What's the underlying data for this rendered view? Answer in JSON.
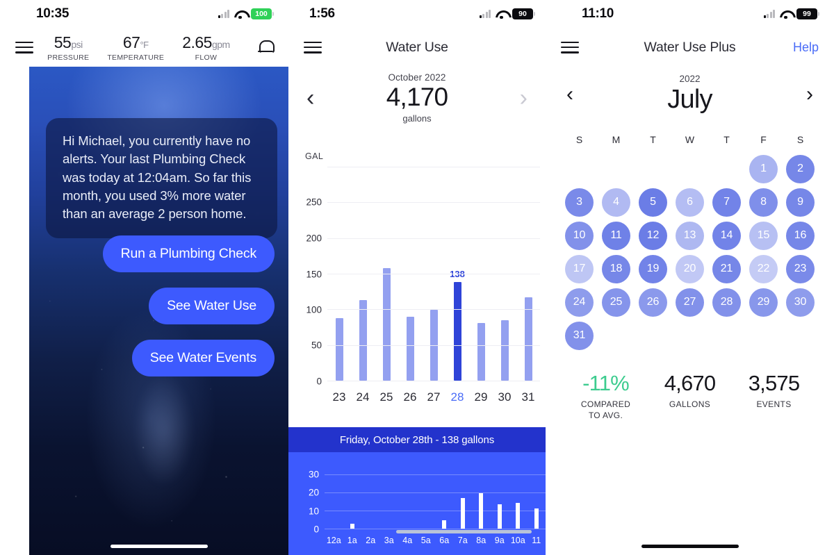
{
  "accent": {
    "blue": "#3d5afe",
    "bar_light": "#93a0f0",
    "bar_selected": "#2f44d8",
    "green": "#3dcc8f",
    "link": "#4a6cf7"
  },
  "panel1": {
    "status": {
      "time": "10:35",
      "battery": "100",
      "battery_color": "#2fd158",
      "battery_text_color": "#ffffff"
    },
    "nav": {
      "menu_icon": "hamburger-icon",
      "bell_icon": "bell-icon",
      "metrics": [
        {
          "value": "55",
          "unit": "psi",
          "label": "PRESSURE"
        },
        {
          "value": "67",
          "unit": "°F",
          "label": "TEMPERATURE"
        },
        {
          "value": "2.65",
          "unit": "gpm",
          "label": "FLOW"
        }
      ]
    },
    "message": "Hi Michael, you currently have no alerts. Your last Plumbing Check was today at 12:04am. So far this month, you used 3% more water than an average 2 person home.",
    "buttons": [
      "Run a Plumbing Check",
      "See Water Use",
      "See Water Events"
    ]
  },
  "panel2": {
    "status": {
      "time": "1:56",
      "battery": "90",
      "battery_color": "#0b0b0f",
      "battery_text_color": "#ffffff"
    },
    "nav": {
      "title": "Water Use",
      "menu_icon": "hamburger-icon"
    },
    "period": {
      "prev_icon": "chevron-left-icon",
      "next_icon": "chevron-right-icon",
      "label": "October 2022",
      "total": "4,170",
      "unit": "gallons"
    },
    "detail": {
      "title": "Friday, October 28th - 138 gallons"
    },
    "chart_data": {
      "type": "bar",
      "title": "October 2022 daily water use",
      "xlabel": "",
      "ylabel": "GAL",
      "axis_unit_label": "GAL",
      "categories": [
        "23",
        "24",
        "25",
        "26",
        "27",
        "28",
        "29",
        "30",
        "31"
      ],
      "values": [
        88,
        113,
        158,
        90,
        99,
        138,
        81,
        85,
        117
      ],
      "yticks": [
        0,
        50,
        100,
        150,
        200,
        250
      ],
      "ylim": [
        0,
        300
      ],
      "grid": true,
      "selected_index": 5,
      "selected_label": "138",
      "legend": "none"
    },
    "detail_chart_data": {
      "type": "bar",
      "title": "Friday, October 28th - 138 gallons",
      "xlabel": "",
      "ylabel": "",
      "categories": [
        "12a",
        "1a",
        "2a",
        "3a",
        "4a",
        "5a",
        "6a",
        "7a",
        "8a",
        "9a",
        "10a",
        "11"
      ],
      "values": [
        0,
        2.5,
        0,
        0,
        0,
        0,
        4.5,
        17,
        19.5,
        13.5,
        14,
        11
      ],
      "yticks": [
        0,
        10,
        20,
        30
      ],
      "ylim": [
        0,
        36
      ],
      "grid": true,
      "scrollbar": true
    }
  },
  "panel3": {
    "status": {
      "time": "11:10",
      "battery": "99",
      "battery_color": "#0b0b0f",
      "battery_text_color": "#ffffff"
    },
    "nav": {
      "title": "Water Use Plus",
      "menu_icon": "hamburger-icon",
      "help": "Help"
    },
    "period": {
      "prev_icon": "chevron-left-icon",
      "next_icon": "chevron-right-icon",
      "year": "2022",
      "month": "July"
    },
    "calendar": {
      "dow": [
        "S",
        "M",
        "T",
        "W",
        "T",
        "F",
        "S"
      ],
      "weeks": [
        [
          null,
          null,
          null,
          null,
          null,
          {
            "d": "1",
            "a": 0.55
          },
          {
            "d": "2",
            "a": 0.88
          }
        ],
        [
          {
            "d": "3",
            "a": 0.85
          },
          {
            "d": "4",
            "a": 0.5
          },
          {
            "d": "5",
            "a": 0.95
          },
          {
            "d": "6",
            "a": 0.48
          },
          {
            "d": "7",
            "a": 0.9
          },
          {
            "d": "8",
            "a": 0.82
          },
          {
            "d": "9",
            "a": 0.88
          }
        ],
        [
          {
            "d": "10",
            "a": 0.8
          },
          {
            "d": "11",
            "a": 0.92
          },
          {
            "d": "12",
            "a": 0.95
          },
          {
            "d": "13",
            "a": 0.52
          },
          {
            "d": "14",
            "a": 0.9
          },
          {
            "d": "15",
            "a": 0.46
          },
          {
            "d": "16",
            "a": 0.88
          }
        ],
        [
          {
            "d": "17",
            "a": 0.42
          },
          {
            "d": "18",
            "a": 0.88
          },
          {
            "d": "19",
            "a": 0.9
          },
          {
            "d": "20",
            "a": 0.4
          },
          {
            "d": "21",
            "a": 0.88
          },
          {
            "d": "22",
            "a": 0.38
          },
          {
            "d": "23",
            "a": 0.85
          }
        ],
        [
          {
            "d": "24",
            "a": 0.72
          },
          {
            "d": "25",
            "a": 0.78
          },
          {
            "d": "26",
            "a": 0.74
          },
          {
            "d": "27",
            "a": 0.8
          },
          {
            "d": "28",
            "a": 0.8
          },
          {
            "d": "29",
            "a": 0.76
          },
          {
            "d": "30",
            "a": 0.72
          }
        ],
        [
          {
            "d": "31",
            "a": 0.8
          },
          null,
          null,
          null,
          null,
          null,
          null
        ]
      ]
    },
    "stats": [
      {
        "value": "-11%",
        "label": "COMPARED\nTO AVG.",
        "color": "#3dcc8f"
      },
      {
        "value": "4,670",
        "label": "GALLONS",
        "color": "#16161c"
      },
      {
        "value": "3,575",
        "label": "EVENTS",
        "color": "#16161c"
      }
    ]
  }
}
